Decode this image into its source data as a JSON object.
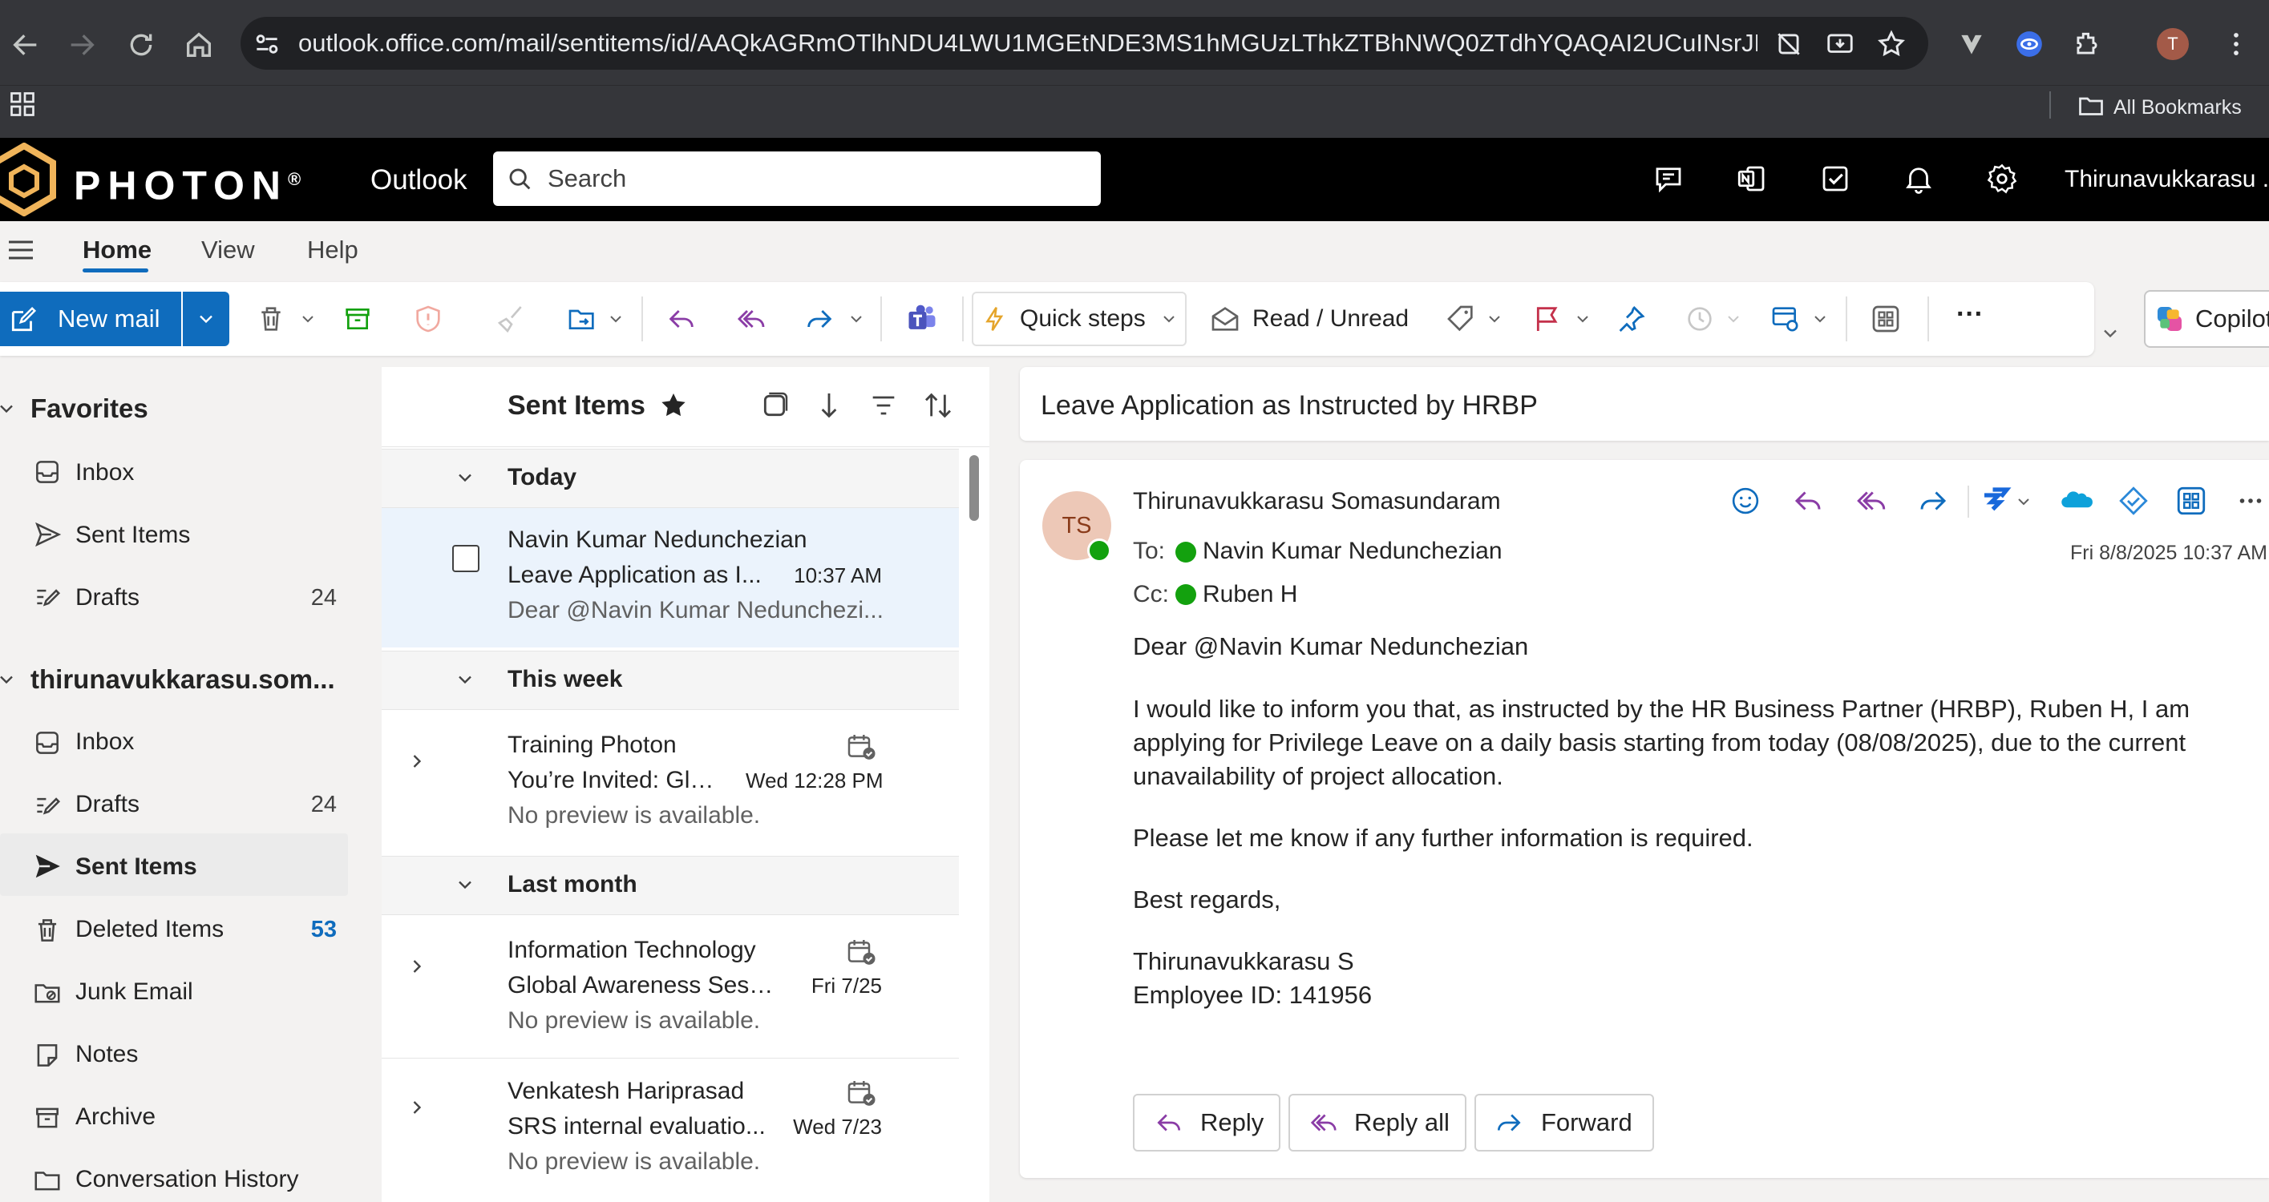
{
  "browser": {
    "url": "outlook.office.com/mail/sentitems/id/AAQkAGRmOTlhNDU4LWU1MGEtNDE3MS1hMGUzLThkZTBhNWQ0ZTdhYQAQAI2UCuINsrJBmCdb...",
    "all_bookmarks": "All Bookmarks",
    "profile_initial": "T"
  },
  "header": {
    "brand": "PHOTON",
    "registered": "®",
    "app_name": "Outlook",
    "search_placeholder": "Search",
    "user_name": "Thirunavukkarasu ..."
  },
  "tabs": [
    "Home",
    "View",
    "Help"
  ],
  "ribbon": {
    "new_mail": "New mail",
    "quick_steps": "Quick steps",
    "read_unread": "Read / Unread",
    "more": "···",
    "copilot": "Copilot"
  },
  "nav": {
    "favorites_label": "Favorites",
    "favorites": [
      {
        "label": "Inbox",
        "count": ""
      },
      {
        "label": "Sent Items",
        "count": ""
      },
      {
        "label": "Drafts",
        "count": "24"
      }
    ],
    "account_label": "thirunavukkarasu.som...",
    "folders": [
      {
        "label": "Inbox",
        "count": ""
      },
      {
        "label": "Drafts",
        "count": "24"
      },
      {
        "label": "Sent Items",
        "count": ""
      },
      {
        "label": "Deleted Items",
        "count": "53"
      },
      {
        "label": "Junk Email",
        "count": ""
      },
      {
        "label": "Notes",
        "count": ""
      },
      {
        "label": "Archive",
        "count": ""
      },
      {
        "label": "Conversation History",
        "count": ""
      }
    ]
  },
  "list": {
    "title": "Sent Items",
    "groups": [
      "Today",
      "This week",
      "Last month"
    ],
    "items": [
      {
        "from": "Navin Kumar Nedunchezian",
        "subject": "Leave Application as I...",
        "time": "10:37 AM",
        "preview": "Dear @Navin Kumar Nedunchezi..."
      },
      {
        "from": "Training Photon",
        "subject": "You’re Invited: Glo...",
        "time": "Wed 12:28 PM",
        "preview": "No preview is available."
      },
      {
        "from": "Information Technology",
        "subject": "Global Awareness Sessi...",
        "time": "Fri 7/25",
        "preview": "No preview is available."
      },
      {
        "from": "Venkatesh Hariprasad",
        "subject": "SRS internal evaluatio...",
        "time": "Wed 7/23",
        "preview": "No preview is available."
      }
    ]
  },
  "reading": {
    "subject": "Leave Application as Instructed by HRBP",
    "avatar_initials": "TS",
    "sender": "Thirunavukkarasu Somasundaram",
    "to_label": "To:",
    "to": "Navin Kumar Nedunchezian",
    "cc_label": "Cc:",
    "cc": "Ruben H",
    "date": "Fri 8/8/2025 10:37 AM",
    "body": [
      "Dear @Navin Kumar Nedunchezian",
      "I would like to inform you that, as instructed by the HR Business Partner (HRBP), Ruben H, I am",
      "applying for Privilege Leave on a daily basis starting from today (08/08/2025), due to the current",
      "unavailability of project allocation.",
      "Please let me know if any further information is required.",
      "Best regards,",
      "Thirunavukkarasu S",
      "Employee ID: 141956"
    ],
    "reply": "Reply",
    "reply_all": "Reply all",
    "forward": "Forward"
  },
  "colors": {
    "accent": "#0f6cbd",
    "reply_purple": "#8a3ca6",
    "presence_green": "#13a10e",
    "brand_gold": "#f0b45a"
  }
}
